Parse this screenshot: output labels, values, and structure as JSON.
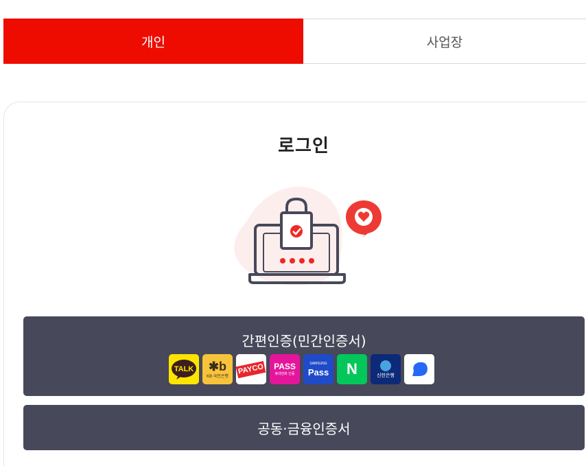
{
  "tabs": {
    "personal": "개인",
    "business": "사업장"
  },
  "login": {
    "title": "로그인"
  },
  "buttons": {
    "simple_auth": "간편인증(민간인증서)",
    "joint_cert": "공동·금융인증서"
  },
  "providers": [
    {
      "name": "kakao",
      "text": "TALK",
      "bg": "#fee500",
      "fg": "#3c1e1e"
    },
    {
      "name": "kb",
      "text": "KB 국민은행",
      "bg": "#f7c33b",
      "fg": "#3a2e1a"
    },
    {
      "name": "payco",
      "text": "PAYCO",
      "bg": "#ffffff",
      "fg": "#e8262b"
    },
    {
      "name": "pass",
      "text": "PASS",
      "sub": "휴대전화 인증",
      "bg": "#e5159b",
      "fg": "#ffffff"
    },
    {
      "name": "samsung-pass",
      "text": "Pass",
      "sub": "SAMSUNG",
      "bg": "#1f4bc9",
      "fg": "#ffffff"
    },
    {
      "name": "naver",
      "text": "N",
      "bg": "#03c75a",
      "fg": "#ffffff"
    },
    {
      "name": "shinhan",
      "text": "신한은행",
      "bg": "#0c2a78",
      "fg": "#ffffff"
    },
    {
      "name": "toss",
      "text": "",
      "bg": "#ffffff",
      "fg": "#2668f5"
    }
  ],
  "colors": {
    "accent": "#ee0c00",
    "button_bg": "#474859"
  }
}
